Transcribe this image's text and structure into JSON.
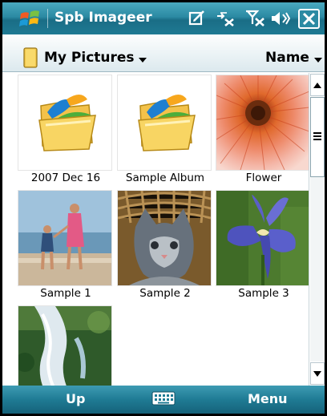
{
  "window": {
    "title": "Spb Imageer",
    "icons": [
      "windows-start-icon",
      "edit-icon",
      "connectivity-icon",
      "signal-off-icon",
      "volume-off-icon",
      "close-icon"
    ]
  },
  "header": {
    "folder": "My Pictures",
    "sort": "Name"
  },
  "items": [
    {
      "label": "2007 Dec 16",
      "type": "album"
    },
    {
      "label": "Sample Album",
      "type": "album"
    },
    {
      "label": "Flower",
      "type": "photo"
    },
    {
      "label": "Sample 1",
      "type": "photo"
    },
    {
      "label": "Sample 2",
      "type": "photo"
    },
    {
      "label": "Sample 3",
      "type": "photo"
    },
    {
      "label": "",
      "type": "photo"
    }
  ],
  "softkeys": {
    "left": "Up",
    "right": "Menu"
  }
}
